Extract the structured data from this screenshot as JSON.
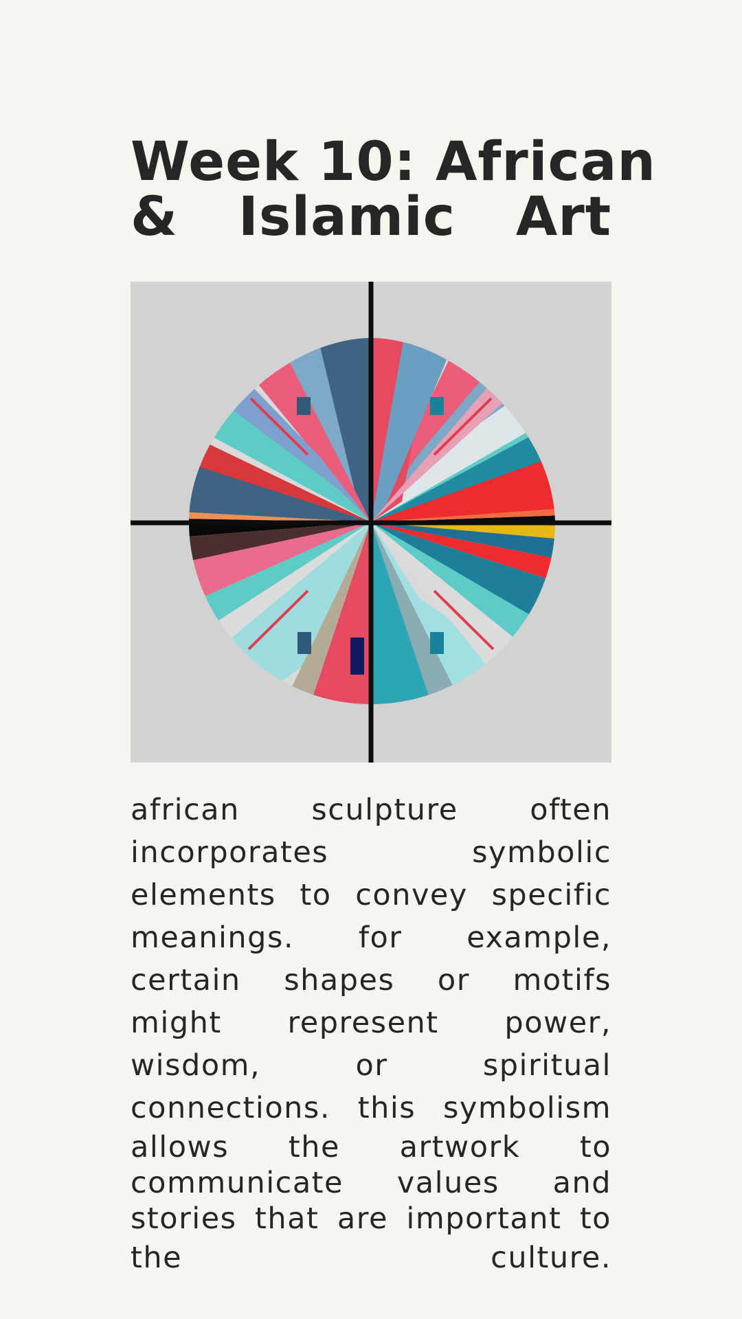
{
  "title": {
    "line1": "Week 10: African",
    "line2": "& Islamic Art"
  },
  "artwork": {
    "palette": [
      "#385f7d",
      "#e54a61",
      "#6a9fc2",
      "#5ecbc7",
      "#d6383b",
      "#e7b716",
      "#1f8aa0",
      "#ea6488",
      "#b3ab96"
    ]
  },
  "body": {
    "lines": [
      "african sculpture often",
      "incorporates symbolic",
      "elements to convey specific",
      "meanings. for example,",
      "certain shapes or motifs",
      "might represent power,",
      "wisdom, or spiritual",
      "connections. this symbolism",
      "allows the artwork to",
      "communicate values and",
      "stories that are important to",
      "the culture."
    ]
  }
}
